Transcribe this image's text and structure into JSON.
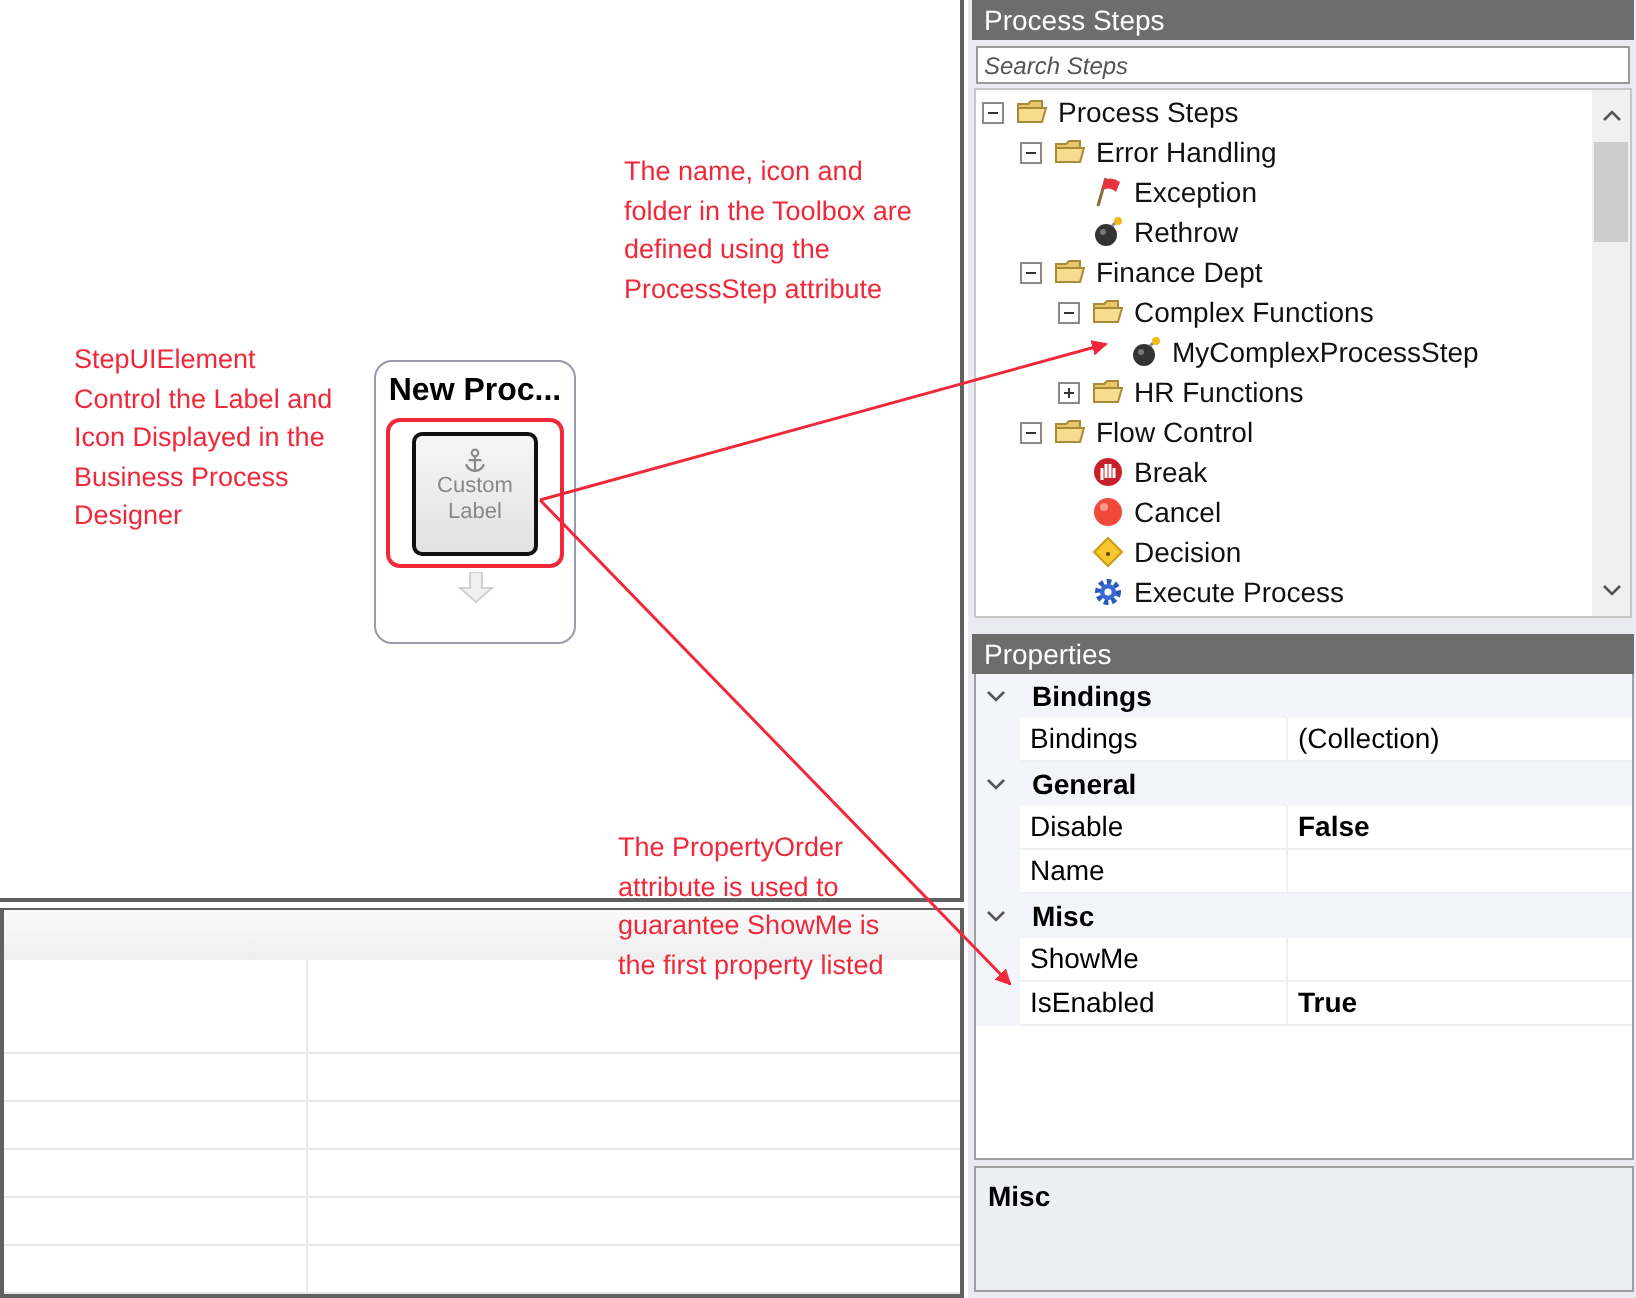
{
  "designer": {
    "node": {
      "title": "New Proc...",
      "label": "Custom Label"
    },
    "annotations": [
      {
        "text": "StepUIElement Control the Label and Icon Displayed in the Business Process Designer"
      },
      {
        "text": "The name, icon and folder in the Toolbox are defined using the ProcessStep attribute"
      },
      {
        "text": "The PropertyOrder attribute is used to guarantee ShowMe is the first property listed"
      }
    ]
  },
  "process_steps": {
    "title": "Process Steps",
    "search": {
      "placeholder": "Search Steps"
    },
    "tree": [
      {
        "label": "Process Steps",
        "kind": "folder",
        "expanded": true,
        "children": [
          {
            "label": "Error Handling",
            "kind": "folder",
            "expanded": true,
            "children": [
              {
                "label": "Exception",
                "kind": "exception"
              },
              {
                "label": "Rethrow",
                "kind": "bomb"
              }
            ]
          },
          {
            "label": "Finance Dept",
            "kind": "folder",
            "expanded": true,
            "children": [
              {
                "label": "Complex Functions",
                "kind": "folder",
                "expanded": true,
                "children": [
                  {
                    "label": "MyComplexProcessStep",
                    "kind": "bomb"
                  }
                ]
              },
              {
                "label": "HR Functions",
                "kind": "folder",
                "expanded": false
              }
            ]
          },
          {
            "label": "Flow Control",
            "kind": "folder",
            "expanded": true,
            "children": [
              {
                "label": "Break",
                "kind": "break"
              },
              {
                "label": "Cancel",
                "kind": "cancel"
              },
              {
                "label": "Decision",
                "kind": "decision"
              },
              {
                "label": "Execute Process",
                "kind": "gear"
              }
            ]
          }
        ]
      }
    ]
  },
  "properties": {
    "title": "Properties",
    "categories": [
      {
        "name": "Bindings",
        "expanded": true,
        "rows": [
          {
            "name": "Bindings",
            "value": "(Collection)",
            "modified": false
          }
        ]
      },
      {
        "name": "General",
        "expanded": true,
        "rows": [
          {
            "name": "Disable",
            "value": "False",
            "modified": true
          },
          {
            "name": "Name",
            "modified": false
          }
        ]
      },
      {
        "name": "Misc",
        "expanded": true,
        "rows": [
          {
            "name": "ShowMe",
            "modified": false
          },
          {
            "name": "IsEnabled",
            "value": "True",
            "modified": true
          }
        ]
      }
    ],
    "description": {
      "title": "Misc"
    }
  }
}
